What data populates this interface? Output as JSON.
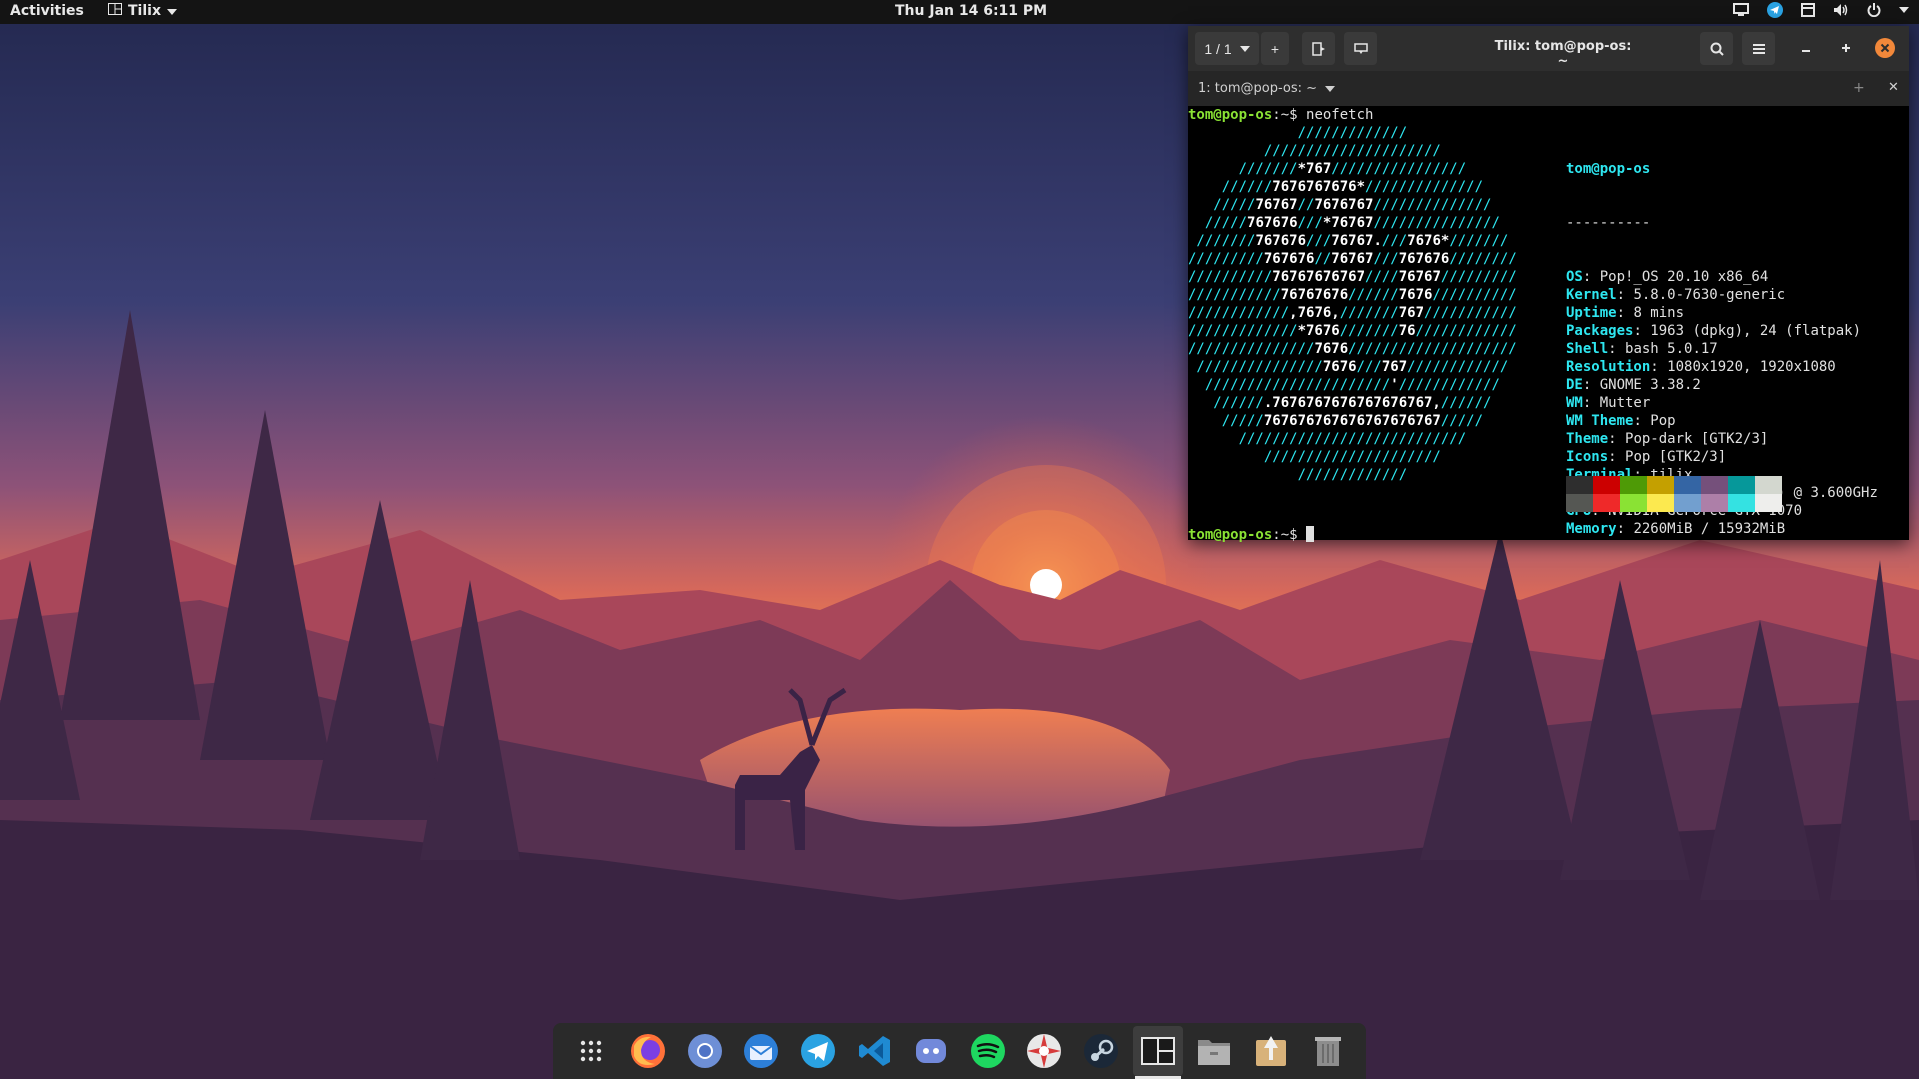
{
  "topbar": {
    "activities": "Activities",
    "app_name": "Tilix",
    "clock": "Thu Jan 14   6:11 PM",
    "tray_icons": [
      "screen-icon",
      "telegram-icon",
      "notes-icon",
      "volume-icon",
      "power-icon",
      "chevron-down-icon"
    ]
  },
  "terminal": {
    "session": "1 / 1",
    "title": "Tilix: tom@pop-os: ~",
    "tab_label": "1: tom@pop-os: ~",
    "prompt_user": "tom@pop-os",
    "prompt_sep": ":~$",
    "command": " neofetch",
    "ascii_art": [
      "             /////////////",
      "         /////////////////////",
      "      ///////*767////////////////",
      "    //////7676767676*//////////////",
      "   /////76767//7676767//////////////",
      "  /////767676///*76767///////////////",
      " ///////767676///76767.///7676*///////",
      "/////////767676//76767///767676////////",
      "//////////76767676767////76767/////////",
      "///////////76767676//////7676//////////",
      "////////////,7676,///////767///////////",
      "/////////////*7676///////76////////////",
      "///////////////7676////////////////////",
      " ///////////////7676///767////////////",
      "  //////////////////////'////////////",
      "   //////.7676767676767676767,//////",
      "    /////767676767676767676767/////",
      "      ///////////////////////////",
      "         /////////////////////",
      "             /////////////"
    ],
    "info_user": "tom@pop-os",
    "info_rule": "----------",
    "info": [
      {
        "k": "OS",
        "v": "Pop!_OS 20.10 x86_64"
      },
      {
        "k": "Kernel",
        "v": "5.8.0-7630-generic"
      },
      {
        "k": "Uptime",
        "v": "8 mins"
      },
      {
        "k": "Packages",
        "v": "1963 (dpkg), 24 (flatpak)"
      },
      {
        "k": "Shell",
        "v": "bash 5.0.17"
      },
      {
        "k": "Resolution",
        "v": "1080x1920, 1920x1080"
      },
      {
        "k": "DE",
        "v": "GNOME 3.38.2"
      },
      {
        "k": "WM",
        "v": "Mutter"
      },
      {
        "k": "WM Theme",
        "v": "Pop"
      },
      {
        "k": "Theme",
        "v": "Pop-dark [GTK2/3]"
      },
      {
        "k": "Icons",
        "v": "Pop [GTK2/3]"
      },
      {
        "k": "Terminal",
        "v": "tilix"
      },
      {
        "k": "CPU",
        "v": "AMD Ryzen 5 3600 (12) @ 3.600GHz"
      },
      {
        "k": "GPU",
        "v": "NVIDIA GeForce GTX 1070"
      },
      {
        "k": "Memory",
        "v": "2260MiB / 15932MiB"
      }
    ],
    "palette_top": [
      "#2e2e2e",
      "#cc0000",
      "#4e9a06",
      "#c4a000",
      "#3465a4",
      "#75507b",
      "#06989a",
      "#d3d7cf"
    ],
    "palette_bottom": [
      "#555753",
      "#ef2929",
      "#8ae234",
      "#fce94f",
      "#729fcf",
      "#ad7fa8",
      "#34e2e2",
      "#eeeeec"
    ]
  },
  "dock": {
    "items": [
      "app-grid-icon",
      "firefox-icon",
      "chromium-icon",
      "thunderbird-icon",
      "telegram-icon",
      "vscode-icon",
      "discord-icon",
      "spotify-icon",
      "lutris-icon",
      "steam-icon",
      "tilix-icon",
      "files-icon",
      "installer-icon",
      "trash-icon"
    ],
    "active": "tilix-icon"
  },
  "colors": {
    "accent_close": "#f2883a",
    "prompt_green": "#8ae234",
    "ascii_cyan": "#2ee6f0"
  }
}
